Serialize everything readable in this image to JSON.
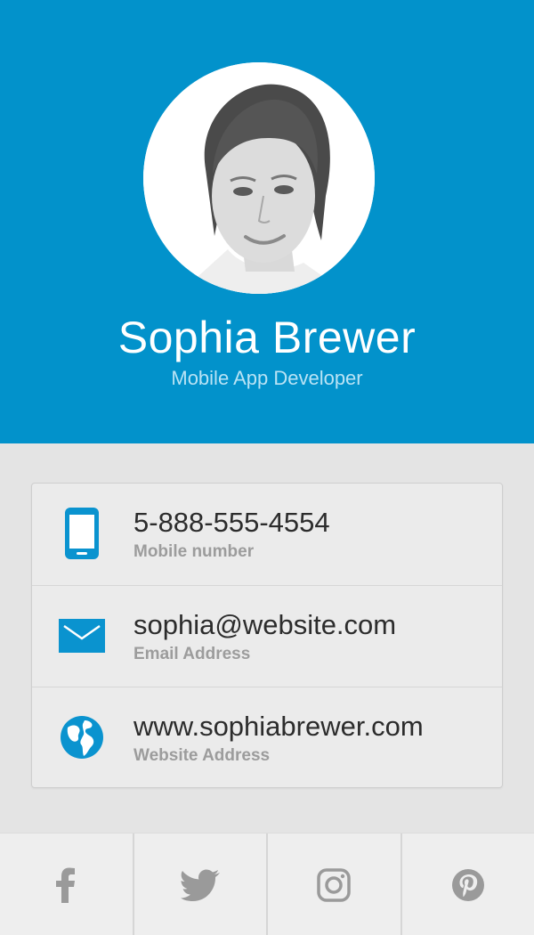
{
  "profile": {
    "name": "Sophia Brewer",
    "role": "Mobile App Developer"
  },
  "contacts": [
    {
      "icon": "phone-icon",
      "value": "5-888-555-4554",
      "label": "Mobile number"
    },
    {
      "icon": "mail-icon",
      "value": "sophia@website.com",
      "label": "Email Address"
    },
    {
      "icon": "globe-icon",
      "value": "www.sophiabrewer.com",
      "label": "Website Address"
    }
  ],
  "social": [
    {
      "icon": "facebook-icon"
    },
    {
      "icon": "twitter-icon"
    },
    {
      "icon": "instagram-icon"
    },
    {
      "icon": "pinterest-icon"
    }
  ],
  "colors": {
    "header": "#0292cb",
    "accent": "#0a93cf",
    "background": "#e4e4e4",
    "social_icon": "#9a9a9a"
  }
}
